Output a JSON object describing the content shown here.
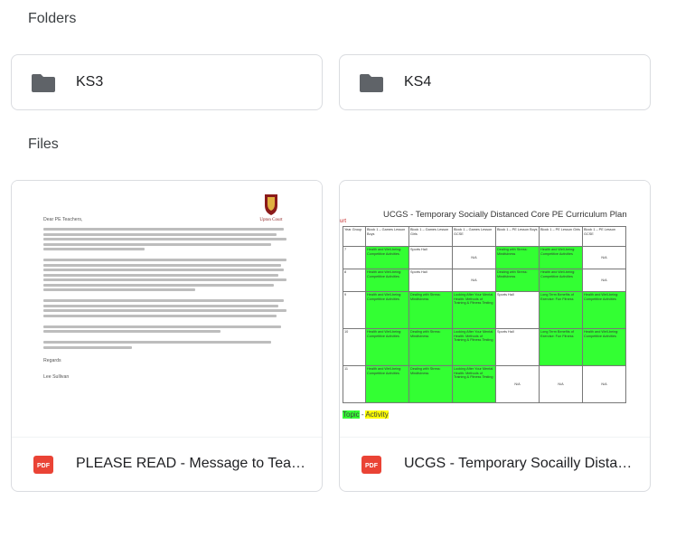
{
  "sections": {
    "folders_title": "Folders",
    "files_title": "Files"
  },
  "folders": [
    {
      "name": "KS3",
      "icon": "folder-icon"
    },
    {
      "name": "KS4",
      "icon": "folder-icon"
    }
  ],
  "files": [
    {
      "name": "PLEASE READ - Message to Teachers",
      "icon": "pdf-icon",
      "preview": {
        "crest_caption": "Upton Court",
        "greeting": "Dear PE Teachers,",
        "closing": "Regards",
        "signature": "Lee Sullivan"
      }
    },
    {
      "name": "UCGS - Temporary Socailly Distanced Core PE Curriculum Plan",
      "icon": "pdf-icon",
      "preview": {
        "title": "UCGS - Temporary Socially Distanced Core PE Curriculum Plan",
        "side_mark": "urt",
        "headers": [
          "Year Group",
          "Block 1 – Games Lesson Boys",
          "Block 1 – Games Lesson Girls",
          "Block 1 – Games Lesson GCSE",
          "Block 1 – PE Lesson Boys",
          "Block 1 – PE Lesson Girls",
          "Block 1 – PE Lesson GCSE"
        ],
        "rows": [
          {
            "year": "7",
            "cells": [
              "Health and Well-being: Competitive Activities",
              "Sports Hall",
              "N/A",
              "Dealing with Stress: Mindfulness",
              "Health and Well-being: Competitive Activities",
              "N/A"
            ]
          },
          {
            "year": "8",
            "cells": [
              "Health and Well-being: Competitive Activities",
              "Sports Hall",
              "N/A",
              "Dealing with Stress: Mindfulness",
              "Health and Well-being: Competitive Activities",
              "N/A"
            ]
          },
          {
            "year": "9",
            "cells": [
              "Health and Well-being: Competitive Activities",
              "Dealing with Stress: Mindfulness",
              "Looking After Your Mental Health: Methods of Training & Fitness Testing",
              "Sports Hall",
              "Long Term Benefits of Exercise: Fun Fitness",
              "Health and Well-being: Competitive Activities"
            ]
          },
          {
            "year": "10",
            "cells": [
              "Health and Well-being: Competitive Activities",
              "Dealing with Stress: Mindfulness",
              "Looking After Your Mental Health: Methods of Training & Fitness Testing",
              "Sports Hall",
              "Long Term Benefits of Exercise: Fun Fitness",
              "Health and Well-being: Competitive Activities"
            ]
          },
          {
            "year": "11",
            "cells": [
              "Health and Well-being: Competitive Activities",
              "Dealing with Stress: Mindfulness",
              "Looking After Your Mental Health: Methods of Training & Fitness Testing",
              "N/A",
              "N/A",
              "N/A"
            ]
          }
        ],
        "legend_topic": "Topic",
        "legend_activity": "Activity"
      }
    }
  ],
  "colors": {
    "border": "#dadce0",
    "folder_icon": "#5f6368",
    "pdf_red": "#ea4335",
    "highlight_green": "#33ff33",
    "highlight_yellow": "#ffff00"
  }
}
